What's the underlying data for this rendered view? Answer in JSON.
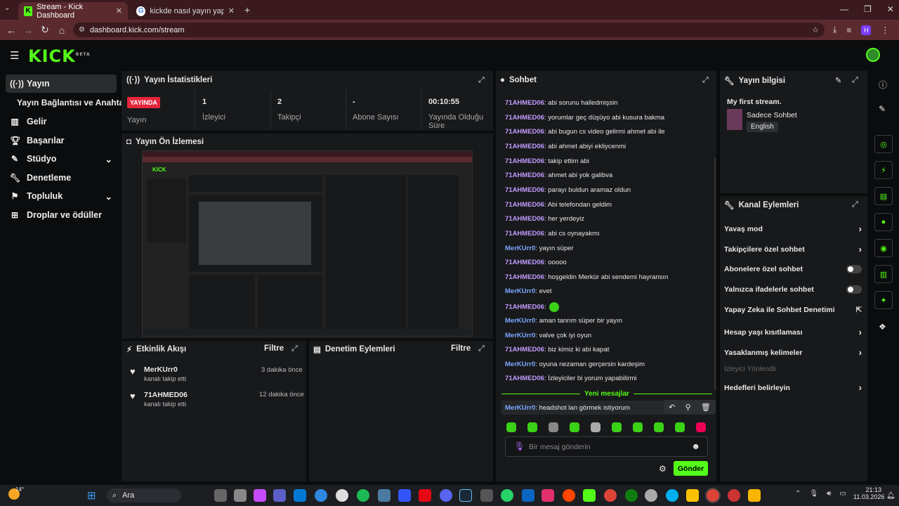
{
  "browser": {
    "tabs": [
      {
        "label": "Stream - Kick Dashboard"
      },
      {
        "label": "kickde nasıl yayın yapılır - Goo"
      }
    ],
    "url": "dashboard.kick.com/stream",
    "profile_letter": "H"
  },
  "brand": {
    "logo": "KICK",
    "beta": "BETA",
    "accent": "#53fc18"
  },
  "sidebar": {
    "items": [
      {
        "label": "Yayın"
      },
      {
        "label": "Yayın Bağlantısı ve Anahtarı"
      },
      {
        "label": "Gelir"
      },
      {
        "label": "Başarılar"
      },
      {
        "label": "Stüdyo"
      },
      {
        "label": "Denetleme"
      },
      {
        "label": "Topluluk"
      },
      {
        "label": "Droplar ve ödüller"
      }
    ]
  },
  "stats": {
    "title": "Yayın İstatistikleri",
    "badge": "YAYINDA",
    "badge_label": "Yayın",
    "viewers": "1",
    "viewers_label": "İzleyici",
    "followers": "2",
    "followers_label": "Takipçi",
    "subs": "-",
    "subs_label": "Abone Sayısı",
    "duration": "00:10:55",
    "duration_label": "Yayında Olduğu Süre"
  },
  "preview": {
    "title": "Yayın Ön İzlemesi"
  },
  "activity": {
    "title": "Etkinlik Akışı",
    "filter": "Filtre",
    "items": [
      {
        "user": "MerKUrr0",
        "action": "kanalı takip etti",
        "time": "3 dakika önce"
      },
      {
        "user": "71AHMED06",
        "action": "kanalı takip etti",
        "time": "12 dakika önce"
      }
    ]
  },
  "modlog": {
    "title": "Denetim Eylemleri",
    "filter": "Filtre"
  },
  "chat": {
    "title": "Sohbet",
    "messages": [
      {
        "user": "71AHMED06",
        "text": ": abi sorunu halledmişsin",
        "c": "o"
      },
      {
        "user": "71AHMED06",
        "text": ": yorumlar geç düşüyo abi kusura bakma",
        "c": "o"
      },
      {
        "user": "71AHMED06",
        "text": ": abi bugun cs video gelirmi ahmet abi ile",
        "c": "o"
      },
      {
        "user": "71AHMED06",
        "text": ": abi ahmet abiyi ekliycenmi",
        "c": "o"
      },
      {
        "user": "71AHMED06",
        "text": ": takip ettim abi",
        "c": "o"
      },
      {
        "user": "71AHMED06",
        "text": ": ahmet abi yok galibva",
        "c": "o"
      },
      {
        "user": "71AHMED06",
        "text": ": parayı buldun aramaz oldun",
        "c": "o"
      },
      {
        "user": "71AHMED06",
        "text": ": Abi telefondan geldim",
        "c": "o"
      },
      {
        "user": "71AHMED06",
        "text": ": her yerdeyiz",
        "c": "o"
      },
      {
        "user": "71AHMED06",
        "text": ": abi cs oynayakmı",
        "c": "o"
      },
      {
        "user": "MerKUrr0",
        "text": ": yayın süper",
        "c": "b"
      },
      {
        "user": "71AHMED06",
        "text": ": ooooo",
        "c": "o"
      },
      {
        "user": "71AHMED06",
        "text": ": hoşgeldin Merkür abi sendemi hayransın",
        "c": "o"
      },
      {
        "user": "MerKUrr0",
        "text": ": evet",
        "c": "b"
      },
      {
        "user": "71AHMED06",
        "text": ":",
        "c": "o"
      },
      {
        "user": "MerKUrr0",
        "text": ": aman tanrım süper bir yayın",
        "c": "b"
      },
      {
        "user": "MerKUrr0",
        "text": ": valve çok iyi oyun",
        "c": "b"
      },
      {
        "user": "71AHMED06",
        "text": ": biz kimiz ki abi kapat",
        "c": "o"
      },
      {
        "user": "MerKUrr0",
        "text": ": oyuna nezaman gerçersin kardeşim",
        "c": "b"
      },
      {
        "user": "71AHMED06",
        "text": ": İzleyiciler bi yorum yapabilirmi",
        "c": "o"
      }
    ],
    "new_messages": "Yeni mesajlar",
    "last": {
      "user": "MerKUrr0",
      "text": ": headshot lan görmek istiyorum"
    },
    "placeholder": "Bir mesaj gönderin",
    "send": "Gönder"
  },
  "info": {
    "title": "Yayın bilgisi",
    "stream_title": "My first stream.",
    "category": "Sadece Sohbet",
    "language": "English"
  },
  "actions": {
    "title": "Kanal Eylemleri",
    "items": [
      {
        "label": "Yavaş mod",
        "ctl": "chev"
      },
      {
        "label": "Takipçilere özel sohbet",
        "ctl": "chev"
      },
      {
        "label": "Abonelere özel sohbet",
        "ctl": "toggle"
      },
      {
        "label": "Yalnızca ifadelerle sohbet",
        "ctl": "toggle"
      },
      {
        "label": "Yapay Zeka ile Sohbet Denetimi",
        "ctl": "ext"
      },
      {
        "label": "Hesap yaşı kısıtlaması",
        "ctl": "chev"
      },
      {
        "label": "Yasaklanmış kelimeler",
        "ctl": "chev"
      }
    ],
    "disabled": "İzleyici Yönlendir",
    "last": "Hedefleri belirleyin"
  },
  "taskbar": {
    "weather": "14°",
    "search": "Ara",
    "time": "21:13",
    "date": "11.03.2026"
  }
}
